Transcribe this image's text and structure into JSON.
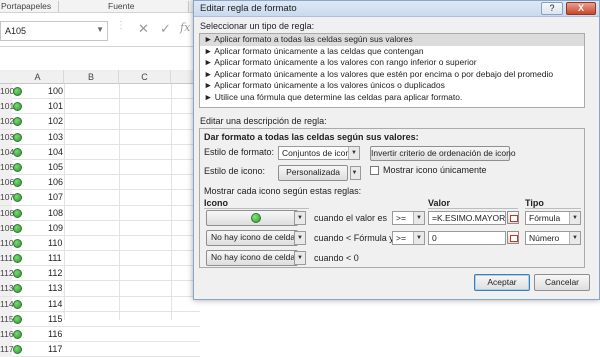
{
  "ribbon": {
    "group1": "Portapapeles",
    "group2": "Fuente"
  },
  "formula_bar": {
    "name_box": "A105",
    "cancel_icon": "✕",
    "enter_icon": "✓",
    "fx_label": "fx"
  },
  "columns": [
    "A",
    "B",
    "C"
  ],
  "rows": [
    {
      "num": "100",
      "value": "100"
    },
    {
      "num": "101",
      "value": "101"
    },
    {
      "num": "102",
      "value": "102"
    },
    {
      "num": "103",
      "value": "103"
    },
    {
      "num": "104",
      "value": "104"
    },
    {
      "num": "105",
      "value": "105"
    },
    {
      "num": "106",
      "value": "106"
    },
    {
      "num": "107",
      "value": "107"
    },
    {
      "num": "108",
      "value": "108"
    },
    {
      "num": "109",
      "value": "109"
    },
    {
      "num": "110",
      "value": "110"
    },
    {
      "num": "111",
      "value": "111"
    },
    {
      "num": "112",
      "value": "112"
    },
    {
      "num": "113",
      "value": "113"
    },
    {
      "num": "114",
      "value": "114"
    },
    {
      "num": "115",
      "value": "115"
    },
    {
      "num": "116",
      "value": "116"
    },
    {
      "num": "117",
      "value": "117"
    }
  ],
  "dialog": {
    "title": "Editar regla de formato",
    "help": "?",
    "close": "X",
    "select_rule_type_label": "Seleccionar un tipo de regla:",
    "rule_types": [
      "► Aplicar formato a todas las celdas según sus valores",
      "► Aplicar formato únicamente a las celdas que contengan",
      "► Aplicar formato únicamente a los valores con rango inferior o superior",
      "► Aplicar formato únicamente a los valores que estén por encima o por debajo del promedio",
      "► Aplicar formato únicamente a los valores únicos o duplicados",
      "► Utilice una fórmula que determine las celdas para aplicar formato."
    ],
    "edit_description_label": "Editar una descripción de regla:",
    "format_all_label": "Dar formato a todas las celdas según sus valores:",
    "format_style_label": "Estilo de formato:",
    "format_style_value": "Conjuntos de iconos",
    "reverse_icon_order": "Invertir criterio de ordenación de icono",
    "icon_style_label": "Estilo de icono:",
    "icon_style_value": "Personalizada",
    "show_icon_only": "Mostrar icono únicamente",
    "show_rules_label": "Mostrar cada icono según estas reglas:",
    "col_icon": "Icono",
    "col_value": "Valor",
    "col_type": "Tipo",
    "rule1": {
      "when": "cuando el valor es",
      "op": ">=",
      "value": "=K.ESIMO.MAYOR($A",
      "type": "Fórmula"
    },
    "rule2": {
      "icon": "No hay icono de celda",
      "when": "cuando < Fórmula y",
      "op": ">=",
      "value": "0",
      "type": "Número"
    },
    "rule3": {
      "icon": "No hay icono de celda",
      "when": "cuando < 0"
    },
    "accept": "Aceptar",
    "cancel": "Cancelar"
  }
}
